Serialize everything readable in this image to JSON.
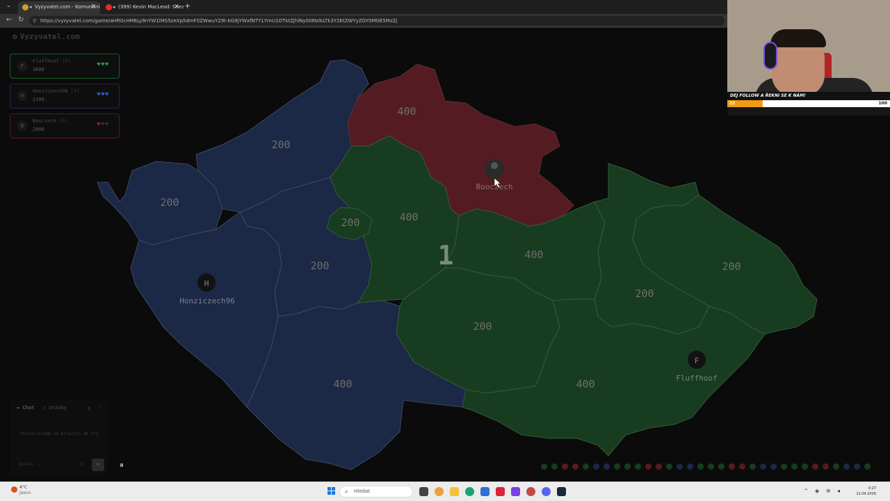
{
  "browser": {
    "tabs": [
      {
        "title": "Vyzyvatel.com - Komunitní vě",
        "active": true,
        "favicon_color": "#c9a227"
      },
      {
        "title": "(399) Kevin MacLeod: Sneaky",
        "active": false,
        "favicon_color": "#e52d27"
      }
    ],
    "new_tab": "+",
    "tab_close": "✕",
    "url": "https://vyzyvatel.com/game/aHR0cHM6Ly9nYW1lMS5zeXp5dmF0ZWwuY29t-bG9jYWxfNTY1YmU1OTktZjhlNy00MzlkLTk3Y2EtZWYyZGY0MGE5MzZj"
  },
  "game": {
    "logo": "Vyzyvatel.com",
    "players": [
      {
        "initial": "F",
        "name": "Fluffhoof",
        "tag": "[0]",
        "score": "3600",
        "color": "#1f9d4a",
        "border": "#1b5e2b",
        "hearts": [
          "♥",
          "♥",
          "♥"
        ],
        "hearts_full": 3
      },
      {
        "initial": "H",
        "name": "Honziczech96",
        "tag": "[0]",
        "score": "2100",
        "color": "#2a5ad0",
        "border": "#1a2c55",
        "hearts": [
          "♥",
          "♥",
          "♥"
        ],
        "hearts_full": 3
      },
      {
        "initial": "B",
        "name": "Booczech",
        "tag": "[0]",
        "score": "2000",
        "color": "#a11d2a",
        "border": "#5a1a20",
        "hearts": [
          "♥",
          "♥",
          "♥"
        ],
        "hearts_full": 1
      }
    ],
    "map": {
      "region_values": {
        "blue_nw": "200",
        "blue_w": "200",
        "blue_mid": "200",
        "blue_s": "400",
        "red_n": "400",
        "green_small": "200",
        "green_c": "400",
        "green_ce": "400",
        "green_e": "200",
        "green_se": "200",
        "green_cs": "200",
        "green_ss": "400"
      },
      "round_number": "1",
      "bases": [
        {
          "initial": "H",
          "name": "Honziczech96"
        },
        {
          "initial": "B",
          "name": "Booczech"
        },
        {
          "initial": "F",
          "name": "Fluffhoof"
        }
      ]
    },
    "chat": {
      "tab_chat": "Chat",
      "tab_questions": "otázky",
      "message": "Honziczech96 se připojil do hry",
      "input_placeholder": "Zpráva...",
      "send_icon": "➤"
    },
    "pause_icon": "⏸"
  },
  "webcam": {
    "banner": "DEJ FOLLOW A ŘEKNI SE K NÁM!",
    "level": "22",
    "max": "100",
    "progress_fraction": 0.22
  },
  "taskbar": {
    "weather_temp": "4°C",
    "weather_desc": "Jasno",
    "search_placeholder": "Hledat",
    "time": "0:27",
    "date": "12.04.2026"
  }
}
